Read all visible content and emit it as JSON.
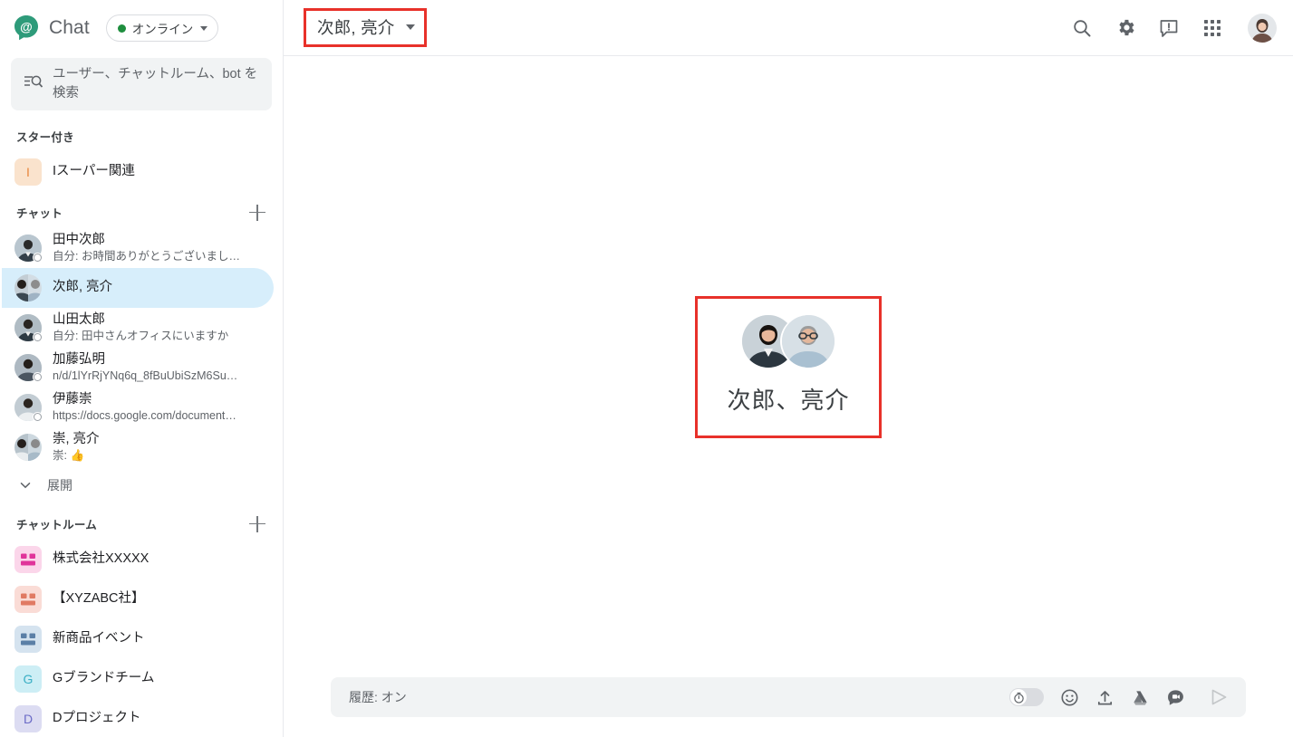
{
  "sidebar": {
    "brand": {
      "name": "Chat",
      "logo_icon": "chat-at-logo"
    },
    "status": {
      "label": "オンライン",
      "dot_color": "#1e8e3e",
      "caret_icon": "caret-down-icon"
    },
    "search": {
      "placeholder": "ユーザー、チャットルーム、bot を検索",
      "icon": "search-list-icon"
    },
    "sections": {
      "starred": {
        "title": "スター付き"
      },
      "chats": {
        "title": "チャット",
        "add_icon": "plus-icon"
      },
      "rooms": {
        "title": "チャットルーム",
        "add_icon": "plus-icon"
      }
    },
    "starred_items": [
      {
        "label": "Iスーパー関連",
        "initial": "I",
        "bg": "#fae3cd",
        "fg": "#e8873c"
      }
    ],
    "chats": [
      {
        "name": "田中次郎",
        "preview": "自分: お時間ありがとうございまし…",
        "avatar": "photo-male-1",
        "selected": false,
        "presence": "offline"
      },
      {
        "name": "次郎, 亮介",
        "preview": "",
        "avatar": "duo-photo",
        "selected": true,
        "presence": "none"
      },
      {
        "name": "山田太郎",
        "preview": "自分: 田中さんオフィスにいますか",
        "avatar": "photo-male-2",
        "selected": false,
        "presence": "offline"
      },
      {
        "name": "加藤弘明",
        "preview": "n/d/1lYrRjYNq6q_8fBuUbiSzM6Su…",
        "avatar": "photo-male-3",
        "selected": false,
        "presence": "offline"
      },
      {
        "name": "伊藤崇",
        "preview": "https://docs.google.com/document…",
        "avatar": "photo-male-4",
        "selected": false,
        "presence": "offline"
      },
      {
        "name": "崇, 亮介",
        "preview": "崇: 👍",
        "avatar": "duo-photo",
        "selected": false,
        "presence": "none"
      }
    ],
    "expand": {
      "label": "展開",
      "icon": "chevron-down-icon"
    },
    "rooms": [
      {
        "label": "株式会社XXXXX",
        "icon": "people-group-icon",
        "bg": "#fbd6ea",
        "fg": "#e0349a"
      },
      {
        "label": "【XYZABC社】",
        "icon": "people-group-icon",
        "bg": "#fadcd6",
        "fg": "#e07a63"
      },
      {
        "label": "新商品イベント",
        "icon": "people-group-icon",
        "bg": "#d5e3ef",
        "fg": "#5b7fa6"
      },
      {
        "label": "Gブランドチーム",
        "icon": "letter-avatar",
        "initial": "G",
        "bg": "#cdeef5",
        "fg": "#39aec4"
      },
      {
        "label": "Dプロジェクト",
        "icon": "letter-avatar",
        "initial": "D",
        "bg": "#dcdcf2",
        "fg": "#6b6bc7"
      }
    ]
  },
  "topbar": {
    "conversation_title": "次郎, 亮介",
    "title_caret_icon": "caret-down-icon",
    "highlight_color": "#e8312a",
    "actions": [
      {
        "name": "search-icon",
        "label": "検索"
      },
      {
        "name": "gear-icon",
        "label": "設定"
      },
      {
        "name": "feedback-icon",
        "label": "フィードバック"
      },
      {
        "name": "apps-grid-icon",
        "label": "Google アプリ"
      }
    ],
    "account_avatar": "account-photo"
  },
  "conversation": {
    "empty_state": {
      "name": "次郎、亮介",
      "avatars": [
        "photo-male-1",
        "photo-male-5"
      ],
      "highlight_color": "#e8312a"
    }
  },
  "compose": {
    "placeholder": "履歴: オン",
    "history_toggle": {
      "state": "on",
      "icon": "history-timer-icon"
    },
    "icons": [
      {
        "name": "emoji-icon"
      },
      {
        "name": "upload-icon"
      },
      {
        "name": "google-drive-icon"
      },
      {
        "name": "video-chat-icon"
      }
    ],
    "send": {
      "icon": "send-icon"
    }
  }
}
